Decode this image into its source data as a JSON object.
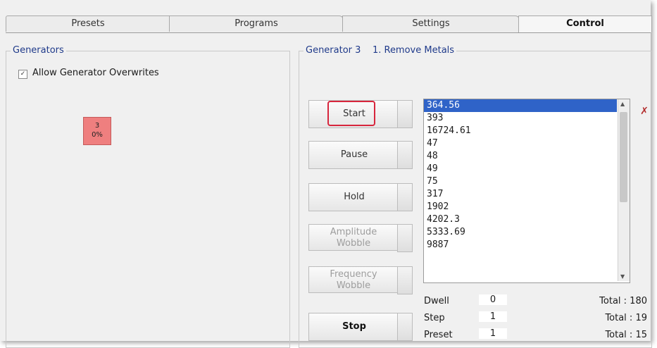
{
  "tabs": [
    {
      "label": "Presets"
    },
    {
      "label": "Programs"
    },
    {
      "label": "Settings"
    },
    {
      "label": "Control"
    }
  ],
  "generators": {
    "title": "Generators",
    "allow_overwrites_label": "Allow Generator Overwrites",
    "allow_overwrites_checked": true,
    "tile_number": "3",
    "tile_percent": "0%"
  },
  "generator3": {
    "title": "Generator 3",
    "program": "1. Remove Metals"
  },
  "buttons": {
    "start": "Start",
    "pause": "Pause",
    "hold": "Hold",
    "amplitude_line1": "Amplitude",
    "amplitude_line2": "Wobble",
    "frequency_line1": "Frequency",
    "frequency_line2": "Wobble",
    "stop": "Stop"
  },
  "frequencies": [
    "364.56",
    "393",
    "16724.61",
    "47",
    "48",
    "49",
    "75",
    "317",
    "1902",
    "4202.3",
    "5333.69",
    "9887"
  ],
  "stats": {
    "dwell_label": "Dwell",
    "dwell_value": "0",
    "dwell_total": "Total : 180",
    "step_label": "Step",
    "step_value": "1",
    "step_total": "Total : 19",
    "preset_label": "Preset",
    "preset_value": "1",
    "preset_total": "Total : 15"
  },
  "colors": {
    "accent_red": "#d7263d",
    "tile_red": "#ef7f7f",
    "selection_blue": "#2f63c8"
  },
  "icons": {
    "clear": "eraser-icon",
    "scroll_up": "up-arrow",
    "scroll_down": "down-arrow"
  }
}
